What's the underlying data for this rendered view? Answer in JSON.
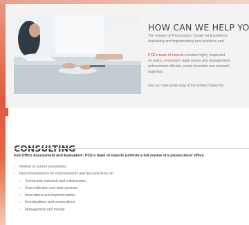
{
  "help": {
    "title": "HOW CAN WE HELP YOU?",
    "para1_line1": "The mission of Prosecutors' Center for Excellence",
    "para1_line2": "evaluating and implementing best practices and",
    "para2_link": "PCE's team of experts",
    "para2_line1_rest": " includes highly respected",
    "para2_line2": "on policy, innovation, legal issues and management",
    "para2_line3": "enforcement officials, social scientists and research",
    "para2_line4": "expertise.",
    "para3": "See our interactive map of the United States for"
  },
  "consulting": {
    "title": "CONSULTING",
    "lead": "Full-Office Assessment and Evaluation: PCE's team of experts perform a full review of a prosecutors' office",
    "items": [
      {
        "text": "Review of current procedures",
        "level": 1
      },
      {
        "text": "Recommendations for improvements and best practices on:",
        "level": 1
      },
      {
        "text": "Community outreach and collaboration",
        "level": 2
      },
      {
        "text": "Data collection and data systems",
        "level": 2
      },
      {
        "text": "Innovations and implementation",
        "level": 2
      },
      {
        "text": "Investigations and prosecutions",
        "level": 2
      },
      {
        "text": "Management and morale",
        "level": 2
      }
    ]
  },
  "icons": {
    "bullet_level1": "›",
    "bullet_level2": "○"
  }
}
